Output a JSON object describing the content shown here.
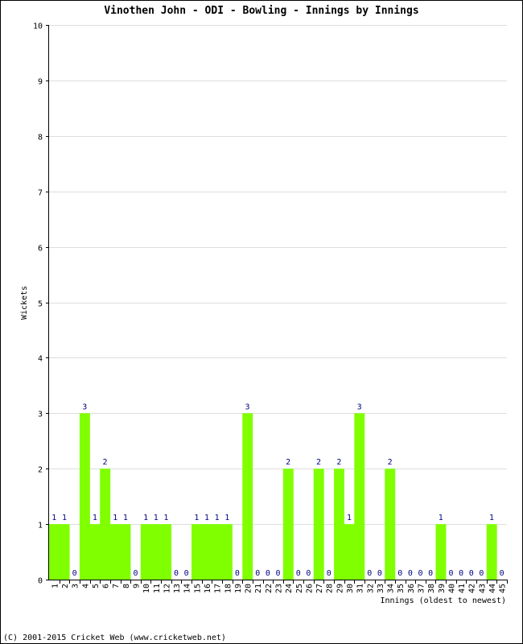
{
  "chart_data": {
    "type": "bar",
    "title": "Vinothen John - ODI - Bowling - Innings by Innings",
    "xlabel": "Innings (oldest to newest)",
    "ylabel": "Wickets",
    "ylim": [
      0,
      10
    ],
    "yticks": [
      0,
      1,
      2,
      3,
      4,
      5,
      6,
      7,
      8,
      9,
      10
    ],
    "grid": true,
    "bar_color": "#80ff00",
    "label_color": "#000080",
    "categories": [
      "1",
      "2",
      "3",
      "4",
      "5",
      "6",
      "7",
      "8",
      "9",
      "10",
      "11",
      "12",
      "13",
      "14",
      "15",
      "16",
      "17",
      "18",
      "19",
      "20",
      "21",
      "22",
      "23",
      "24",
      "25",
      "26",
      "27",
      "28",
      "29",
      "30",
      "31",
      "32",
      "33",
      "34",
      "35",
      "36",
      "37",
      "38",
      "39",
      "40",
      "41",
      "42",
      "43",
      "44",
      "45"
    ],
    "values": [
      1,
      1,
      0,
      3,
      1,
      2,
      1,
      1,
      0,
      1,
      1,
      1,
      0,
      0,
      1,
      1,
      1,
      1,
      0,
      3,
      0,
      0,
      0,
      2,
      0,
      0,
      2,
      0,
      2,
      1,
      3,
      0,
      0,
      2,
      0,
      0,
      0,
      0,
      1,
      0,
      0,
      0,
      0,
      1,
      0
    ]
  },
  "footer": "(C) 2001-2015 Cricket Web (www.cricketweb.net)"
}
